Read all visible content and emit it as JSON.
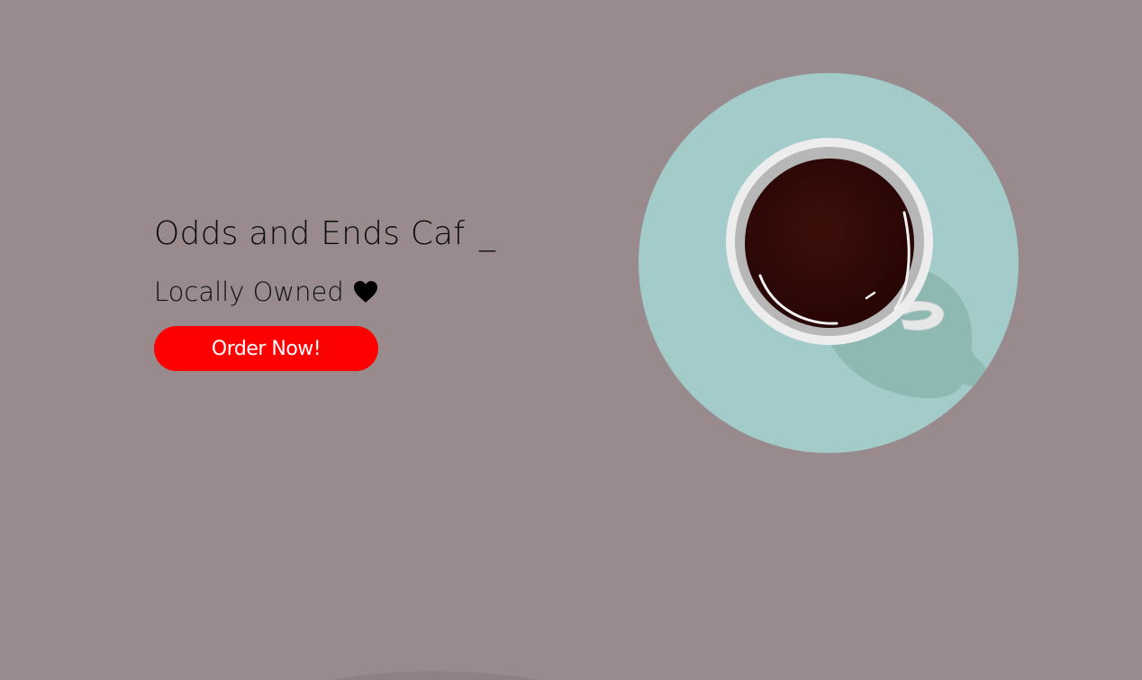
{
  "hero": {
    "title": "Odds and Ends Caf",
    "cursor": "_",
    "tagline": "Locally Owned",
    "order_button_label": "Order Now!"
  },
  "icons": {
    "heart": "heart-icon",
    "coffee": "coffee-cup-illustration"
  },
  "colors": {
    "background": "#988a8d",
    "button": "#ff0000",
    "button_text": "#ffffff",
    "saucer": "#a2cbc9"
  }
}
